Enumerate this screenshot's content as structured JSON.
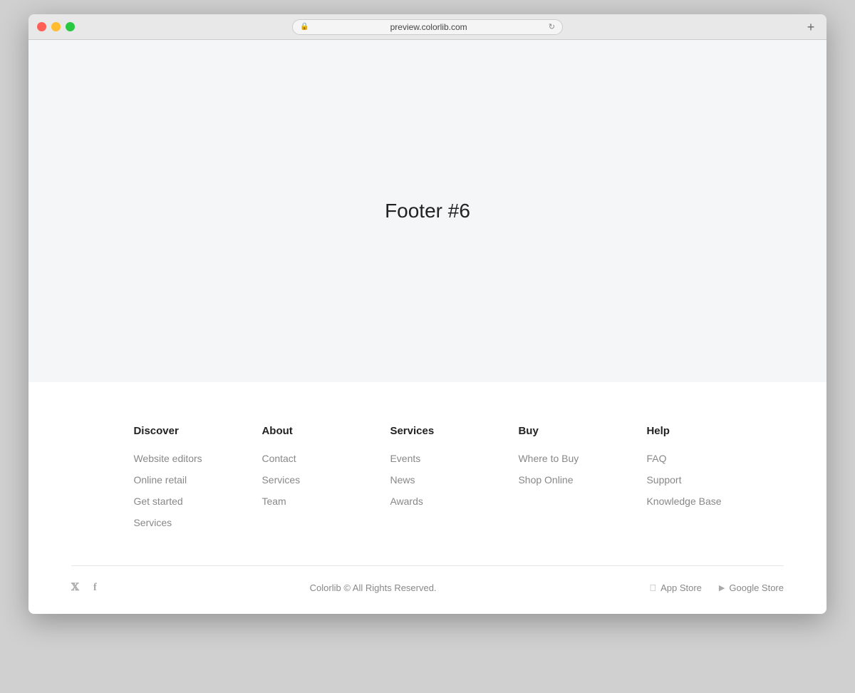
{
  "browser": {
    "url": "preview.colorlib.com",
    "new_tab_label": "+"
  },
  "page": {
    "title": "Footer #6"
  },
  "footer": {
    "columns": [
      {
        "id": "discover",
        "heading": "Discover",
        "links": [
          {
            "label": "Website editors"
          },
          {
            "label": "Online retail"
          },
          {
            "label": "Get started"
          },
          {
            "label": "Services"
          }
        ]
      },
      {
        "id": "about",
        "heading": "About",
        "links": [
          {
            "label": "Contact"
          },
          {
            "label": "Services"
          },
          {
            "label": "Team"
          }
        ]
      },
      {
        "id": "services",
        "heading": "Services",
        "links": [
          {
            "label": "Events"
          },
          {
            "label": "News"
          },
          {
            "label": "Awards"
          }
        ]
      },
      {
        "id": "buy",
        "heading": "Buy",
        "links": [
          {
            "label": "Where to Buy"
          },
          {
            "label": "Shop Online"
          }
        ]
      },
      {
        "id": "help",
        "heading": "Help",
        "links": [
          {
            "label": "FAQ"
          },
          {
            "label": "Support"
          },
          {
            "label": "Knowledge Base"
          }
        ]
      }
    ],
    "copyright": "Colorlib © All Rights Reserved.",
    "social": [
      {
        "id": "twitter",
        "icon": "𝕏",
        "label": "Twitter"
      },
      {
        "id": "facebook",
        "icon": "f",
        "label": "Facebook"
      }
    ],
    "stores": [
      {
        "id": "app-store",
        "icon": "♦",
        "label": "App Store"
      },
      {
        "id": "google-store",
        "icon": "▶",
        "label": "Google Store"
      }
    ]
  }
}
